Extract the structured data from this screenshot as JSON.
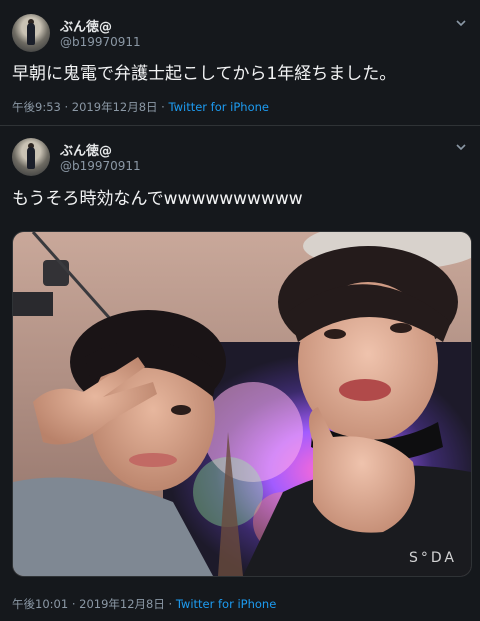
{
  "tweets": [
    {
      "display_name": "ぶん徳@",
      "handle": "@b19970911",
      "text": "早朝に鬼電で弁護士起こしてから1年経ちました。",
      "time": "午後9:53",
      "date": "2019年12月8日",
      "source": "Twitter for iPhone",
      "menu_icon": "chevron-down-icon"
    },
    {
      "display_name": "ぶん徳@",
      "handle": "@b19970911",
      "text": "もうそろ時効なんでwwwwwwwwww",
      "time": "午後10:01",
      "date": "2019年12月8日",
      "source": "Twitter for iPhone",
      "menu_icon": "chevron-down-icon",
      "photo_watermark": "S°DA"
    }
  ],
  "colors": {
    "background": "#15181c",
    "text": "#e7e9ea",
    "secondary_text": "#8b98a5",
    "link": "#1d9bf0",
    "divider": "#2f3336"
  }
}
